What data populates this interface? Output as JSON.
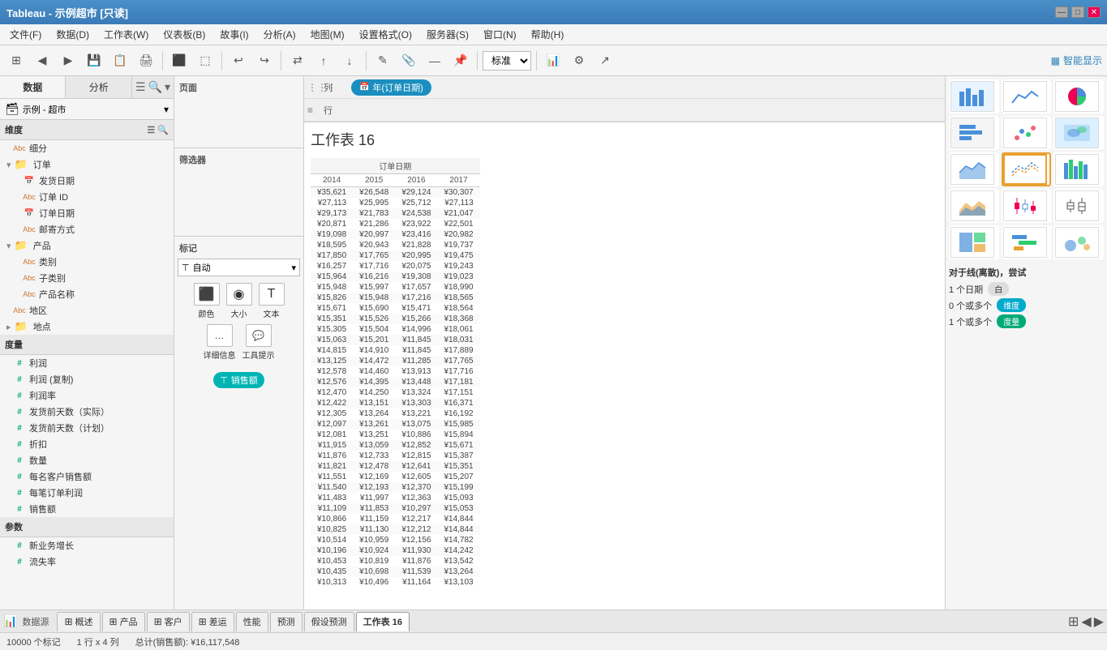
{
  "titleBar": {
    "title": "Tableau - 示例超市 [只读]",
    "controls": [
      "—",
      "□",
      "✕"
    ]
  },
  "menuBar": {
    "items": [
      "文件(F)",
      "数据(D)",
      "工作表(W)",
      "仪表板(B)",
      "故事(I)",
      "分析(A)",
      "地图(M)",
      "设置格式(O)",
      "服务器(S)",
      "窗口(N)",
      "帮助(H)"
    ]
  },
  "toolbar": {
    "smartShow": "智能显示"
  },
  "leftPanel": {
    "tabs": [
      "数据",
      "分析"
    ],
    "dataSource": "示例 - 超市",
    "dimensions": {
      "label": "维度",
      "items": [
        {
          "name": "细分",
          "type": "Abc"
        },
        {
          "name": "订单",
          "type": "group",
          "children": [
            {
              "name": "发货日期",
              "type": "date"
            },
            {
              "name": "订单 ID",
              "type": "Abc"
            },
            {
              "name": "订单日期",
              "type": "date"
            },
            {
              "name": "邮寄方式",
              "type": "Abc"
            }
          ]
        },
        {
          "name": "产品",
          "type": "group",
          "children": [
            {
              "name": "类别",
              "type": "Abc"
            },
            {
              "name": "子类别",
              "type": "Abc"
            },
            {
              "name": "产品名称",
              "type": "Abc"
            }
          ]
        },
        {
          "name": "地区",
          "type": "Abc"
        },
        {
          "name": "地点",
          "type": "group",
          "children": []
        }
      ]
    },
    "measures": {
      "label": "度量",
      "items": [
        {
          "name": "利润",
          "type": "#"
        },
        {
          "name": "利润 (复制)",
          "type": "#"
        },
        {
          "name": "利润率",
          "type": "#"
        },
        {
          "name": "发货前天数（实际）",
          "type": "#"
        },
        {
          "name": "发货前天数（计划）",
          "type": "#"
        },
        {
          "name": "折扣",
          "type": "#"
        },
        {
          "name": "数量",
          "type": "#"
        },
        {
          "name": "每名客户销售额",
          "type": "#"
        },
        {
          "name": "每笔订单利润",
          "type": "#"
        },
        {
          "name": "销售额",
          "type": "#"
        }
      ]
    },
    "parameters": {
      "label": "参数",
      "items": [
        {
          "name": "新业务增长",
          "type": "#"
        },
        {
          "name": "流失率",
          "type": "#"
        }
      ]
    }
  },
  "middlePanel": {
    "pagesLabel": "页面",
    "filtersLabel": "筛选器",
    "marksLabel": "标记",
    "marksType": "自动",
    "markButtons": [
      {
        "label": "颜色",
        "icon": "⬛"
      },
      {
        "label": "大小",
        "icon": "◉"
      },
      {
        "label": "文本",
        "icon": "T"
      }
    ],
    "markButtons2": [
      {
        "label": "详细信息",
        "icon": "…"
      },
      {
        "label": "工具提示",
        "icon": "💬"
      }
    ],
    "salesPill": "销售额"
  },
  "shelfArea": {
    "colsLabel": "列",
    "colsPill": "年(订单日期)",
    "rowsLabel": "行"
  },
  "worksheet": {
    "title": "工作表 16",
    "colGroupLabel": "订单日期",
    "years": [
      "2014",
      "2015",
      "2016",
      "2017"
    ],
    "rows": [
      [
        "¥35,621",
        "¥26,548",
        "¥29,124",
        "¥30,307"
      ],
      [
        "¥27,113",
        "¥25,995",
        "¥25,712",
        "¥27,113"
      ],
      [
        "¥29,173",
        "¥21,783",
        "¥24,538",
        "¥21,047"
      ],
      [
        "¥20,871",
        "¥21,286",
        "¥23,922",
        "¥22,501"
      ],
      [
        "¥19,098",
        "¥20,997",
        "¥23,416",
        "¥20,982"
      ],
      [
        "¥18,595",
        "¥20,943",
        "¥21,828",
        "¥19,737"
      ],
      [
        "¥17,850",
        "¥17,765",
        "¥20,995",
        "¥19,475"
      ],
      [
        "¥16,257",
        "¥17,716",
        "¥20,075",
        "¥19,243"
      ],
      [
        "¥15,964",
        "¥16,216",
        "¥19,308",
        "¥19,023"
      ],
      [
        "¥15,948",
        "¥15,997",
        "¥17,657",
        "¥18,990"
      ],
      [
        "¥15,826",
        "¥15,948",
        "¥17,216",
        "¥18,565"
      ],
      [
        "¥15,671",
        "¥15,690",
        "¥15,471",
        "¥18,564"
      ],
      [
        "¥15,351",
        "¥15,526",
        "¥15,266",
        "¥18,368"
      ],
      [
        "¥15,305",
        "¥15,504",
        "¥14,996",
        "¥18,061"
      ],
      [
        "¥15,063",
        "¥15,201",
        "¥11,845",
        "¥18,031"
      ],
      [
        "¥14,815",
        "¥14,910",
        "¥11,845",
        "¥17,889"
      ],
      [
        "¥13,125",
        "¥14,472",
        "¥11,285",
        "¥17,765"
      ],
      [
        "¥12,578",
        "¥14,460",
        "¥13,913",
        "¥17,716"
      ],
      [
        "¥12,576",
        "¥14,395",
        "¥13,448",
        "¥17,181"
      ],
      [
        "¥12,470",
        "¥14,250",
        "¥13,324",
        "¥17,151"
      ],
      [
        "¥12,422",
        "¥13,151",
        "¥13,303",
        "¥16,371"
      ],
      [
        "¥12,305",
        "¥13,264",
        "¥13,221",
        "¥16,192"
      ],
      [
        "¥12,097",
        "¥13,261",
        "¥13,075",
        "¥15,985"
      ],
      [
        "¥12,081",
        "¥13,251",
        "¥10,886",
        "¥15,894"
      ],
      [
        "¥11,915",
        "¥13,059",
        "¥12,852",
        "¥15,671"
      ],
      [
        "¥11,876",
        "¥12,733",
        "¥12,815",
        "¥15,387"
      ],
      [
        "¥11,821",
        "¥12,478",
        "¥12,641",
        "¥15,351"
      ],
      [
        "¥11,551",
        "¥12,169",
        "¥12,605",
        "¥15,207"
      ],
      [
        "¥11,540",
        "¥12,193",
        "¥12,370",
        "¥15,199"
      ],
      [
        "¥11,483",
        "¥11,997",
        "¥12,363",
        "¥15,093"
      ],
      [
        "¥11,109",
        "¥11,853",
        "¥10,297",
        "¥15,053"
      ],
      [
        "¥10,866",
        "¥11,159",
        "¥12,217",
        "¥14,844"
      ],
      [
        "¥10,825",
        "¥11,130",
        "¥12,212",
        "¥14,844"
      ],
      [
        "¥10,514",
        "¥10,959",
        "¥12,156",
        "¥14,782"
      ],
      [
        "¥10,196",
        "¥10,924",
        "¥11,930",
        "¥14,242"
      ],
      [
        "¥10,453",
        "¥10,819",
        "¥11,876",
        "¥13,542"
      ],
      [
        "¥10,435",
        "¥10,698",
        "¥11,539",
        "¥13,264"
      ],
      [
        "¥10,313",
        "¥10,496",
        "¥11,164",
        "¥13,103"
      ]
    ]
  },
  "rightPanel": {
    "smartShowLabel": "智能显示",
    "recommendation": {
      "label": "对于线(离散)，尝试",
      "items": [
        {
          "text": "1 个日期",
          "type": "白"
        },
        {
          "text": "0 个或多个",
          "badge": "维度",
          "badgeColor": "blue"
        },
        {
          "text": "1 个或多个",
          "badge": "度量",
          "badgeColor": "green"
        }
      ]
    }
  },
  "bottomTabs": {
    "leftIcons": [
      "📊"
    ],
    "tabs": [
      {
        "label": "概述",
        "icon": "⊞",
        "active": false
      },
      {
        "label": "产品",
        "icon": "⊞",
        "active": false
      },
      {
        "label": "客户",
        "icon": "⊞",
        "active": false
      },
      {
        "label": "差运",
        "icon": "⊞",
        "active": false
      },
      {
        "label": "性能",
        "active": false
      },
      {
        "label": "预测",
        "active": false
      },
      {
        "label": "假设预测",
        "active": false
      },
      {
        "label": "工作表 16",
        "active": true
      }
    ],
    "rightIcons": [
      "⊞",
      "⊟",
      "⊠"
    ]
  },
  "statusBar": {
    "records": "10000 个标记",
    "rowCol": "1 行 x 4 列",
    "total": "总计(销售额): ¥16,117,548"
  }
}
